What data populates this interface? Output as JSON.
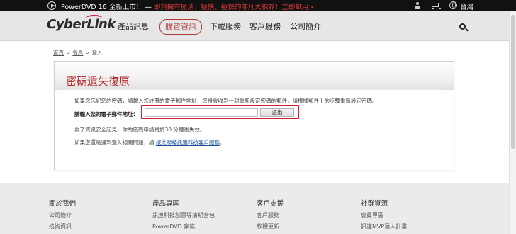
{
  "promo_bar": {
    "text": "PowerDVD 16 全新上市！ — ",
    "highlight": "即刻擁有極清、極快、極快的非凡大視界！立即試用>",
    "region": "台灣"
  },
  "header": {
    "logo": "CyberLink",
    "nav": [
      {
        "label": "產品訊息"
      },
      {
        "label": "購買資訊"
      },
      {
        "label": "下載服務"
      },
      {
        "label": "客戶服務"
      },
      {
        "label": "公司簡介"
      }
    ],
    "active_nav": "購買資訊"
  },
  "breadcrumb": {
    "items": [
      "首頁",
      "會員",
      "登入"
    ],
    "separator": ">"
  },
  "panel": {
    "title": "密碼遺失復原",
    "intro": "如果您忘記您的密碼，請輸入您註冊的電子郵件地址，您將會收到一封重新設定密碼的郵件，請根據郵件上的步驟重新設定密碼。",
    "email_label": "請輸入您的電子郵件地址：",
    "email_value": "",
    "submit_label": "送出",
    "security_note": "為了資訊安全起見，你的密碼申請將於30 分鐘後失效。",
    "help_prefix": "如果您還是遇到登入相關問題，請 ",
    "help_link": "按此聯絡訊連科技客戶服務",
    "help_suffix": "。",
    "highlight_color": "#d2202f",
    "title_color": "#b52828"
  },
  "footer": {
    "columns": [
      {
        "heading": "關於我們",
        "items": [
          "公司簡介",
          "技術資訊"
        ]
      },
      {
        "heading": "產品專區",
        "items": [
          "訊連科技創意導演組合包",
          "PowerDVD 家族"
        ]
      },
      {
        "heading": "客戶支援",
        "items": [
          "客戶服務",
          "軟體更新"
        ]
      },
      {
        "heading": "社群資源",
        "items": [
          "會員專區",
          "訊連MVP達人計畫"
        ]
      }
    ]
  },
  "icons": [
    "play-icon",
    "user-icon",
    "cart-icon",
    "globe-icon",
    "search-icon"
  ]
}
